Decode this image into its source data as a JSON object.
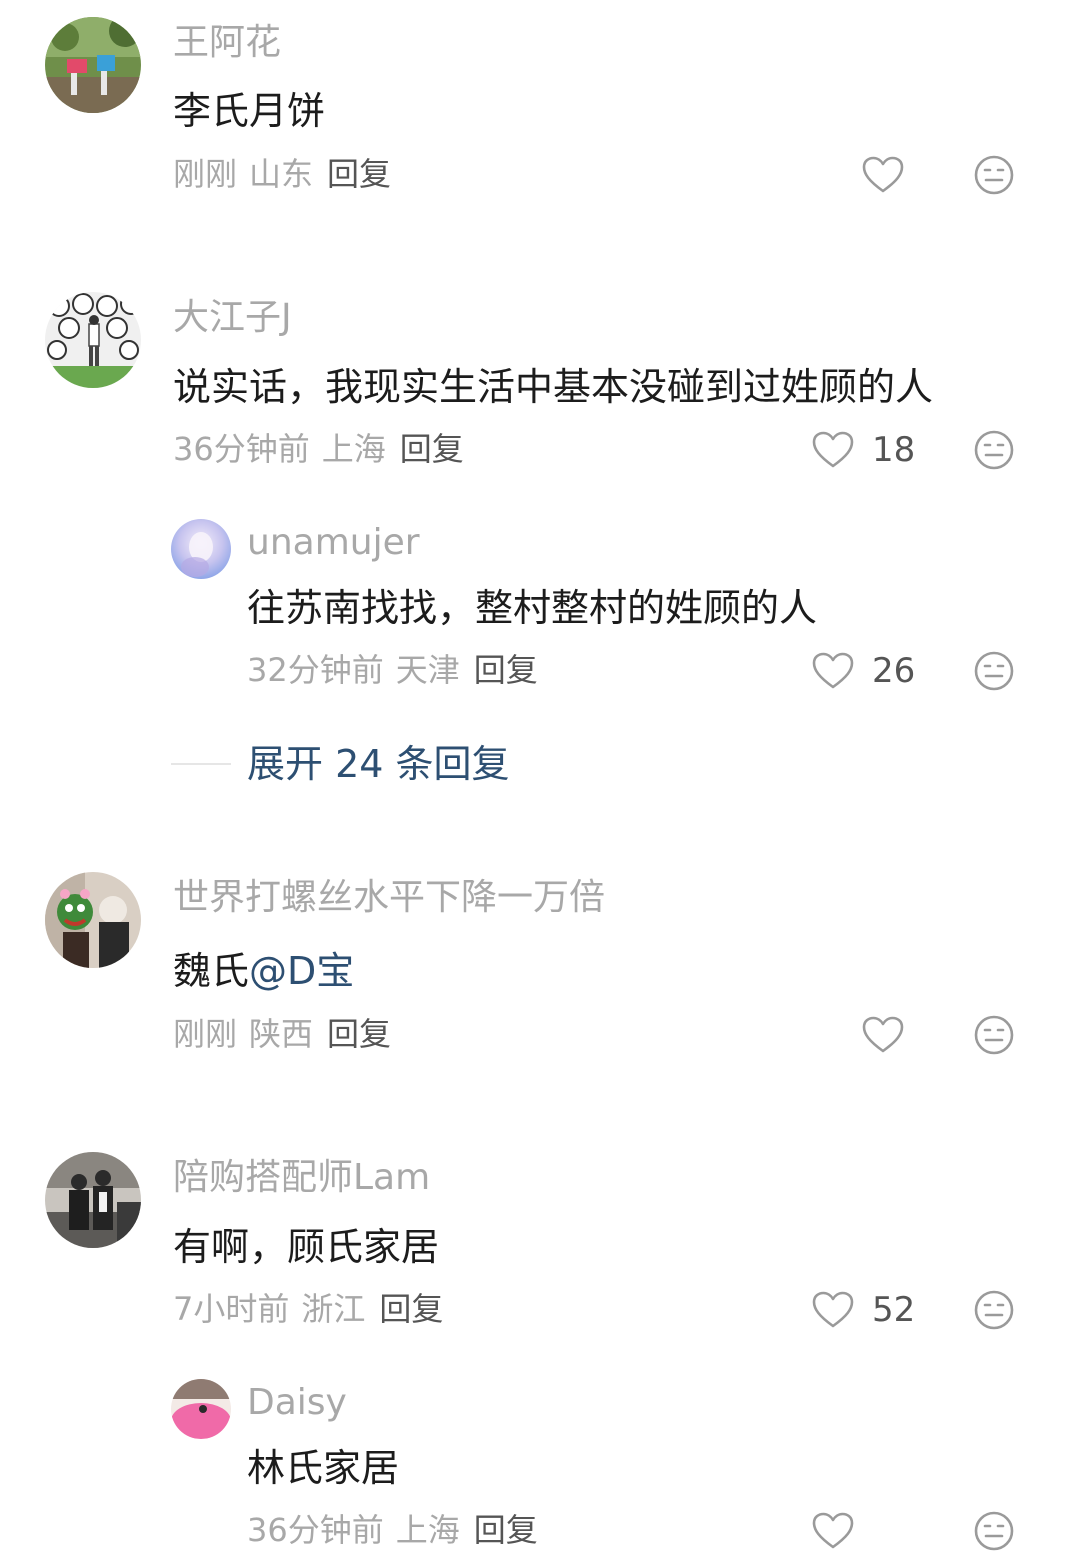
{
  "comments": [
    {
      "username": "王阿花",
      "text": "李氏月饼",
      "time": "刚刚",
      "location": "山东",
      "reply_label": "回复",
      "likes": ""
    },
    {
      "username": "大江子J",
      "text": "说实话，我现实生活中基本没碰到过姓顾的人",
      "time": "36分钟前",
      "location": "上海",
      "reply_label": "回复",
      "likes": "18",
      "replies": [
        {
          "username": "unamujer",
          "text": "往苏南找找，整村整村的姓顾的人",
          "time": "32分钟前",
          "location": "天津",
          "reply_label": "回复",
          "likes": "26"
        }
      ],
      "expand_label": "展开 24 条回复"
    },
    {
      "username": "世界打螺丝水平下降一万倍",
      "text_prefix": "魏氏",
      "mention": "@D宝",
      "time": "刚刚",
      "location": "陕西",
      "reply_label": "回复",
      "likes": ""
    },
    {
      "username": "陪购搭配师Lam",
      "text": "有啊，顾氏家居",
      "time": "7小时前",
      "location": "浙江",
      "reply_label": "回复",
      "likes": "52",
      "replies": [
        {
          "username": "Daisy",
          "text": "林氏家居",
          "time": "36分钟前",
          "location": "上海",
          "reply_label": "回复",
          "likes": ""
        }
      ]
    }
  ],
  "icons": {
    "like": "heart-outline-icon",
    "dislike": "meh-face-icon"
  },
  "colors": {
    "username": "#a8a8a8",
    "text": "#1c1c1c",
    "meta": "#a8a8a8",
    "reply": "#555555",
    "link": "#2d4f72"
  }
}
